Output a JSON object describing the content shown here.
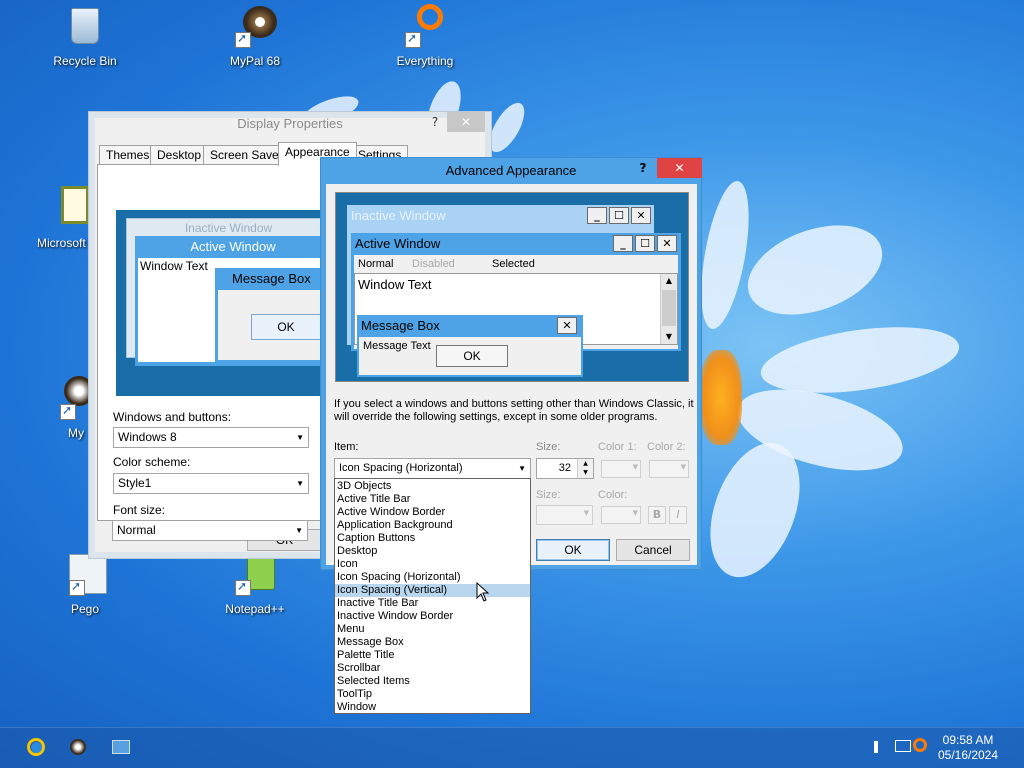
{
  "desktop": {
    "icons": [
      {
        "label": "Recycle Bin",
        "icon": "recycle-bin-icon"
      },
      {
        "label": "MyPal 68",
        "icon": "mypal-icon"
      },
      {
        "label": "Everything",
        "icon": "everything-icon"
      },
      {
        "label": "Microsoft",
        "icon": "microsoft-app-icon"
      },
      {
        "label": "My",
        "icon": "my-app-icon"
      },
      {
        "label": "Pego",
        "icon": "pego-icon"
      },
      {
        "label": "Notepad++",
        "icon": "notepadpp-icon"
      }
    ]
  },
  "display_properties": {
    "title": "Display Properties",
    "help": "?",
    "close": "✕",
    "tabs": [
      "Themes",
      "Desktop",
      "Screen Saver",
      "Appearance",
      "Settings"
    ],
    "preview": {
      "inactive": "Inactive Window",
      "active": "Active Window",
      "window_text": "Window Text",
      "message_box": "Message Box",
      "ok": "OK"
    },
    "windows_buttons_label": "Windows and buttons:",
    "windows_buttons_value": "Windows 8",
    "color_scheme_label": "Color scheme:",
    "color_scheme_value": "Style1",
    "font_size_label": "Font size:",
    "font_size_value": "Normal",
    "ok": "OK"
  },
  "advanced": {
    "title": "Advanced Appearance",
    "help": "?",
    "close": "✕",
    "preview": {
      "inactive": "Inactive Window",
      "active": "Active Window",
      "menu_normal": "Normal",
      "menu_disabled": "Disabled",
      "menu_selected": "Selected",
      "window_text": "Window Text",
      "message_box": "Message Box",
      "message_text": "Message Text",
      "ok": "OK"
    },
    "info": "If you select a windows and buttons setting other than Windows Classic, it will override the following settings, except in some older programs.",
    "item_label": "Item:",
    "item_value": "Icon Spacing (Horizontal)",
    "size_label": "Size:",
    "size_value": "32",
    "color1_label": "Color 1:",
    "color2_label": "Color 2:",
    "font_size_label": "Size:",
    "font_color_label": "Color:",
    "bold": "B",
    "italic": "I",
    "ok": "OK",
    "cancel": "Cancel",
    "items": [
      "3D Objects",
      "Active Title Bar",
      "Active Window Border",
      "Application Background",
      "Caption Buttons",
      "Desktop",
      "Icon",
      "Icon Spacing (Horizontal)",
      "Icon Spacing (Vertical)",
      "Inactive Title Bar",
      "Inactive Window Border",
      "Menu",
      "Message Box",
      "Palette Title",
      "Scrollbar",
      "Selected Items",
      "ToolTip",
      "Window"
    ],
    "highlighted_index": 8
  },
  "taskbar": {
    "time": "09:58 AM",
    "date": "05/16/2024"
  },
  "colors": {
    "accent_blue": "#4da3e6",
    "close_red": "#e04343",
    "list_highlight": "#b9d6ef"
  }
}
